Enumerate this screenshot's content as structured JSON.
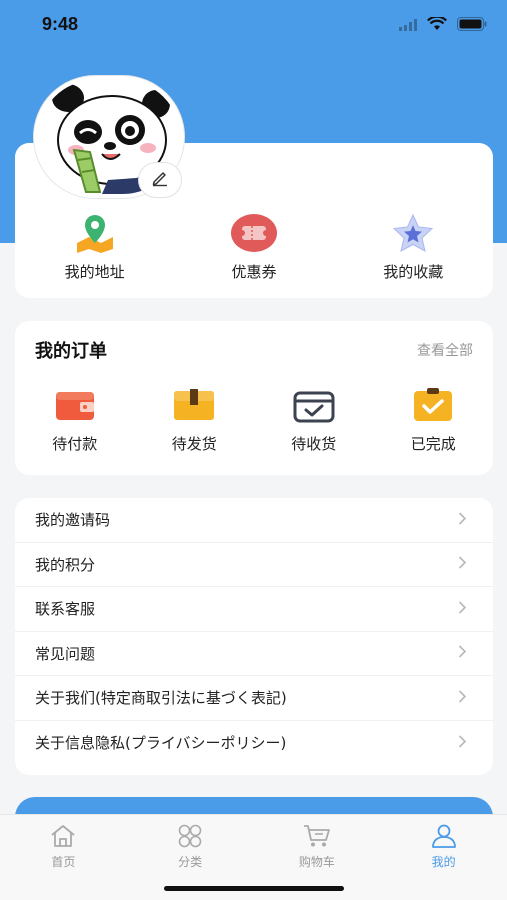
{
  "status_bar": {
    "time": "9:48"
  },
  "profile": {
    "quick_links": [
      {
        "label": "我的地址",
        "icon": "map-pin-icon"
      },
      {
        "label": "优惠券",
        "icon": "ticket-icon"
      },
      {
        "label": "我的收藏",
        "icon": "star-icon"
      }
    ]
  },
  "orders": {
    "title": "我的订单",
    "view_all": "查看全部",
    "items": [
      {
        "label": "待付款",
        "icon": "wallet-icon"
      },
      {
        "label": "待发货",
        "icon": "package-icon"
      },
      {
        "label": "待收货",
        "icon": "inbox-check-icon"
      },
      {
        "label": "已完成",
        "icon": "clipboard-check-icon"
      }
    ]
  },
  "menu": [
    {
      "label": "我的邀请码"
    },
    {
      "label": "我的积分"
    },
    {
      "label": "联系客服"
    },
    {
      "label": "常见问题"
    },
    {
      "label": "关于我们(特定商取引法に基づく表記)"
    },
    {
      "label": "关于信息隐私(プライバシーポリシー)"
    }
  ],
  "tabbar": {
    "active": "我的",
    "tabs": [
      {
        "label": "首页",
        "icon": "home-icon"
      },
      {
        "label": "分类",
        "icon": "grid-icon"
      },
      {
        "label": "购物车",
        "icon": "cart-icon"
      },
      {
        "label": "我的",
        "icon": "user-icon"
      }
    ]
  },
  "colors": {
    "primary": "#4a9be8",
    "background": "#f4f5f7",
    "order_orange": "#f5a623",
    "coupon_red": "#e05a5a"
  }
}
